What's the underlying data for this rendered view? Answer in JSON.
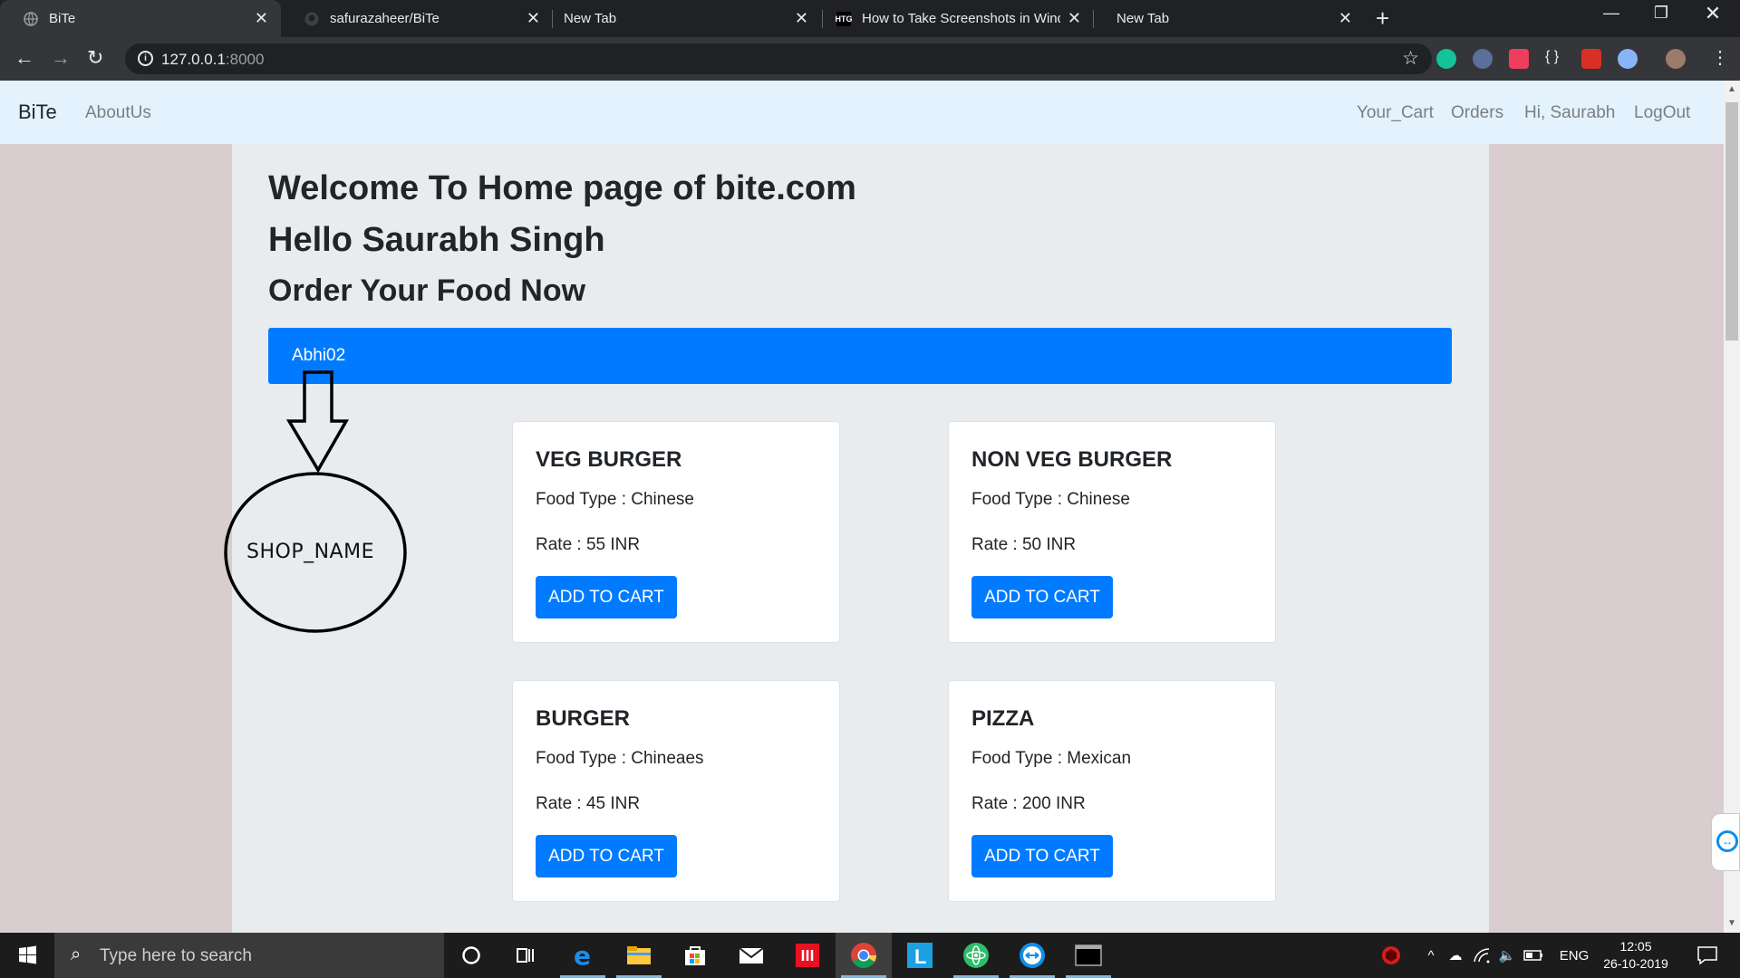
{
  "browser": {
    "tabs": [
      {
        "title": "BiTe",
        "active": true
      },
      {
        "title": "safurazaheer/BiTe",
        "active": false
      },
      {
        "title": "New Tab",
        "active": false
      },
      {
        "title": "How to Take Screenshots in Wind",
        "active": false,
        "favicon_text": "HTG"
      },
      {
        "title": "New Tab",
        "active": false
      }
    ],
    "url_host": "127.0.0.1",
    "url_port": ":8000"
  },
  "navbar": {
    "brand": "BiTe",
    "about": "AboutUs",
    "cart": "Your_Cart",
    "orders": "Orders",
    "greeting": "Hi, Saurabh",
    "logout": "LogOut"
  },
  "main": {
    "welcome": "Welcome To Home page of bite.com",
    "hello": "Hello Saurabh Singh",
    "order_heading": "Order Your Food Now",
    "shop_name": "Abhi02"
  },
  "foods": [
    {
      "name": "VEG BURGER",
      "type": "Food Type : Chinese",
      "rate": "Rate : 55 INR",
      "button": "ADD TO CART"
    },
    {
      "name": "NON VEG BURGER",
      "type": "Food Type : Chinese",
      "rate": "Rate : 50 INR",
      "button": "ADD TO CART"
    },
    {
      "name": "BURGER",
      "type": "Food Type : Chineaes",
      "rate": "Rate : 45 INR",
      "button": "ADD TO CART"
    },
    {
      "name": "PIZZA",
      "type": "Food Type : Mexican",
      "rate": "Rate : 200 INR",
      "button": "ADD TO CART"
    }
  ],
  "annotation": {
    "label": "SHOP_NAME"
  },
  "taskbar": {
    "search_placeholder": "Type here to search",
    "language": "ENG",
    "time": "12:05",
    "date": "26-10-2019"
  },
  "colors": {
    "primary": "#007bff",
    "navbar_bg": "#e3f2fd",
    "page_bg": "#d9cdd0",
    "container_bg": "#e9ecef"
  }
}
